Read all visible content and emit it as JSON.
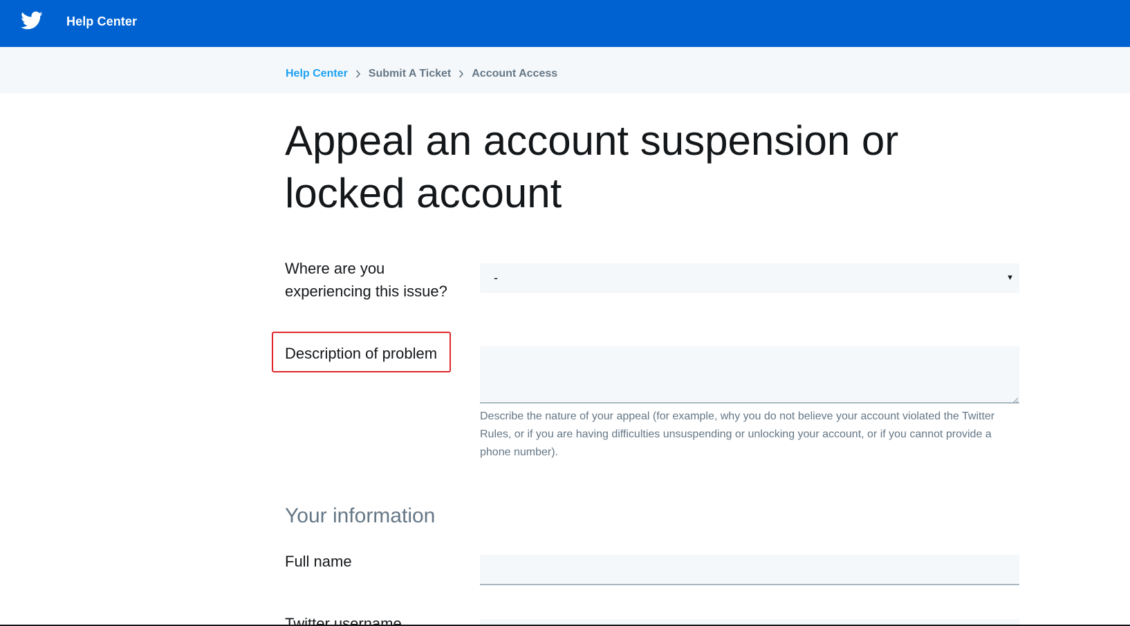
{
  "header": {
    "brand": "Help Center",
    "logo_icon": "twitter-bird-icon",
    "background_color": "#0062d1"
  },
  "breadcrumb": {
    "items": [
      "Help Center",
      "Submit A Ticket",
      "Account Access"
    ],
    "separator_icon": "chevron-right-icon"
  },
  "page": {
    "title": "Appeal an account suspension or locked account"
  },
  "form": {
    "issue_location": {
      "label": "Where are you experiencing this issue?",
      "selected": "-",
      "arrow_icon": "dropdown-arrow-icon"
    },
    "description": {
      "label": "Description of problem",
      "value": "",
      "help": "Describe the nature of your appeal (for example, why you do not believe your account violated the Twitter Rules, or if you are having difficulties unsuspending or unlocking your account, or if you cannot provide a phone number)."
    },
    "your_information": {
      "heading": "Your information"
    },
    "full_name": {
      "label": "Full name",
      "value": ""
    },
    "twitter_username": {
      "label": "Twitter username"
    }
  },
  "colors": {
    "link": "#1da1f2",
    "highlight": "#e0262b",
    "field_bg": "#f5f8fa"
  }
}
